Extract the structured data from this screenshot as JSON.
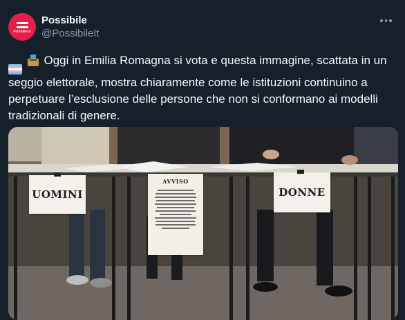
{
  "author": {
    "display_name": "Possibile",
    "handle": "@PossibileIt",
    "avatar_text": "POSSIBILE",
    "avatar_color": "#e4204a"
  },
  "post": {
    "emojis": [
      "transgender-flag-icon",
      "ballot-box-icon"
    ],
    "text": "Oggi in Emilia Romagna si vota e questa immagine, scattata in un seggio elettorale, mostra chiaramente come le istituzioni continuino a perpetuare l’esclusione delle persone che non si conformano ai modelli tradizionali di genere."
  },
  "photo": {
    "sign_left": "UOMINI",
    "sign_center_title": "AVVISO",
    "sign_right": "DONNE"
  },
  "colors": {
    "background": "#15202b",
    "text": "#f7f9f9",
    "muted": "#8b98a5"
  }
}
